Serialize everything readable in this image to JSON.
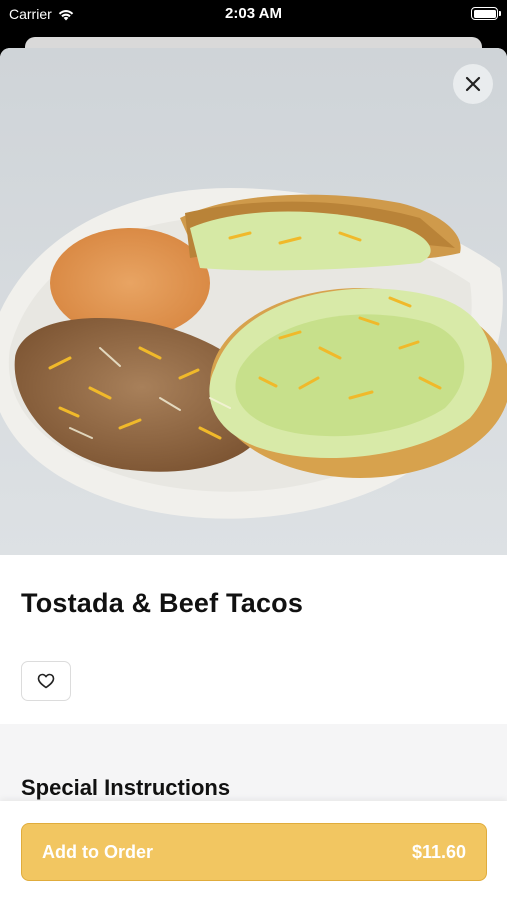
{
  "status_bar": {
    "carrier": "Carrier",
    "time": "2:03 AM"
  },
  "item": {
    "title": "Tostada & Beef Tacos",
    "image": "tostada-and-tacos-plate"
  },
  "icons": {
    "close": "close-icon",
    "favorite": "heart-icon"
  },
  "sections": {
    "special_instructions_title": "Special Instructions"
  },
  "footer": {
    "add_label": "Add to Order",
    "price": "$11.60"
  },
  "colors": {
    "accent": "#f2c661",
    "accent_border": "#e0ac3c"
  }
}
